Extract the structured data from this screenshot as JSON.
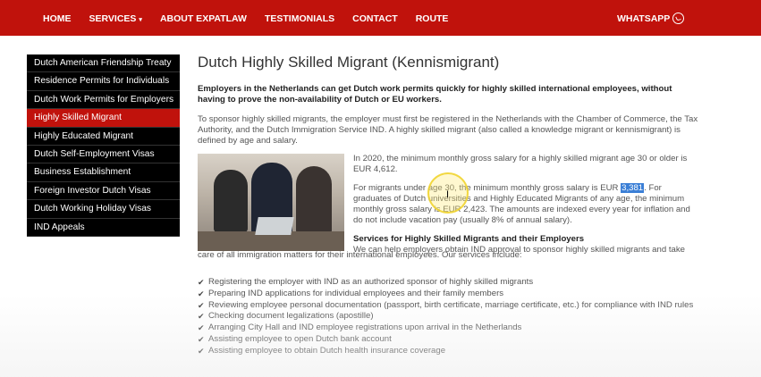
{
  "nav": {
    "items": [
      {
        "label": "HOME"
      },
      {
        "label": "SERVICES"
      },
      {
        "label": "ABOUT EXPATLAW"
      },
      {
        "label": "TESTIMONIALS"
      },
      {
        "label": "CONTACT"
      },
      {
        "label": "ROUTE"
      }
    ],
    "whatsapp_label": "WHATSAPP",
    "services_caret": "▾"
  },
  "sidebar": {
    "items": [
      {
        "label": "Dutch American Friendship Treaty",
        "active": false
      },
      {
        "label": "Residence Permits for Individuals",
        "active": false
      },
      {
        "label": "Dutch Work Permits for Employers",
        "active": false
      },
      {
        "label": "Highly Skilled Migrant",
        "active": true
      },
      {
        "label": "Highly Educated Migrant",
        "active": false
      },
      {
        "label": "Dutch Self-Employment Visas",
        "active": false
      },
      {
        "label": "Business Establishment",
        "active": false
      },
      {
        "label": "Foreign Investor Dutch Visas",
        "active": false
      },
      {
        "label": "Dutch Working Holiday Visas",
        "active": false
      },
      {
        "label": "IND Appeals",
        "active": false
      }
    ]
  },
  "main": {
    "title": "Dutch Highly Skilled Migrant (Kennismigrant)",
    "lead": "Employers in the Netherlands can get Dutch work permits quickly for highly skilled international employees, without having to prove the non-availability of Dutch or EU workers.",
    "intro": "To sponsor highly skilled migrants, the employer must first be registered in the Netherlands with the Chamber of Commerce, the Tax Authority, and the Dutch Immigration Service IND. A highly skilled migrant (also called a knowledge migrant or kennismigrant) is defined by age and salary.",
    "salary_30": "In 2020, the minimum monthly gross salary for a highly skilled migrant age 30 or older is EUR 4,612.",
    "salary_under_pre": "For migrants under age 30, the minimum monthly gross salary is EUR ",
    "salary_under_value": "3,381",
    "salary_under_post": ". For graduates of Dutch universities and Highly Educated Migrants of any age, the minimum monthly gross salary is EUR 2,423. The amounts are indexed every year for inflation and do not include vacation pay (usually 8% of annual salary).",
    "services_heading": "Services for Highly Skilled Migrants and their Employers",
    "services_intro_a": "We can help employers obtain IND approval to sponsor highly skilled migrants and take",
    "services_intro_b": "care of all immigration matters for their international employees. Our services include:",
    "check_glyph": "✔",
    "services": [
      "Registering the employer with IND as an authorized sponsor of highly skilled migrants",
      "Preparing IND applications for individual employees and their family members",
      "Reviewing employee personal documentation (passport, birth certificate, marriage certificate, etc.) for compliance with IND rules",
      "Checking document legalizations (apostille)",
      "Arranging City Hall and IND employee registrations upon arrival in the Netherlands",
      "Assisting employee to open Dutch bank account",
      "Assisting employee to obtain Dutch health insurance coverage"
    ]
  },
  "colors": {
    "brand_red": "#c0120c",
    "sidebar_bg": "#000000",
    "selection": "#3b7fd6"
  },
  "icons": {
    "whatsapp": "whatsapp-icon",
    "check": "check-icon",
    "cursor": "text-cursor-icon"
  }
}
